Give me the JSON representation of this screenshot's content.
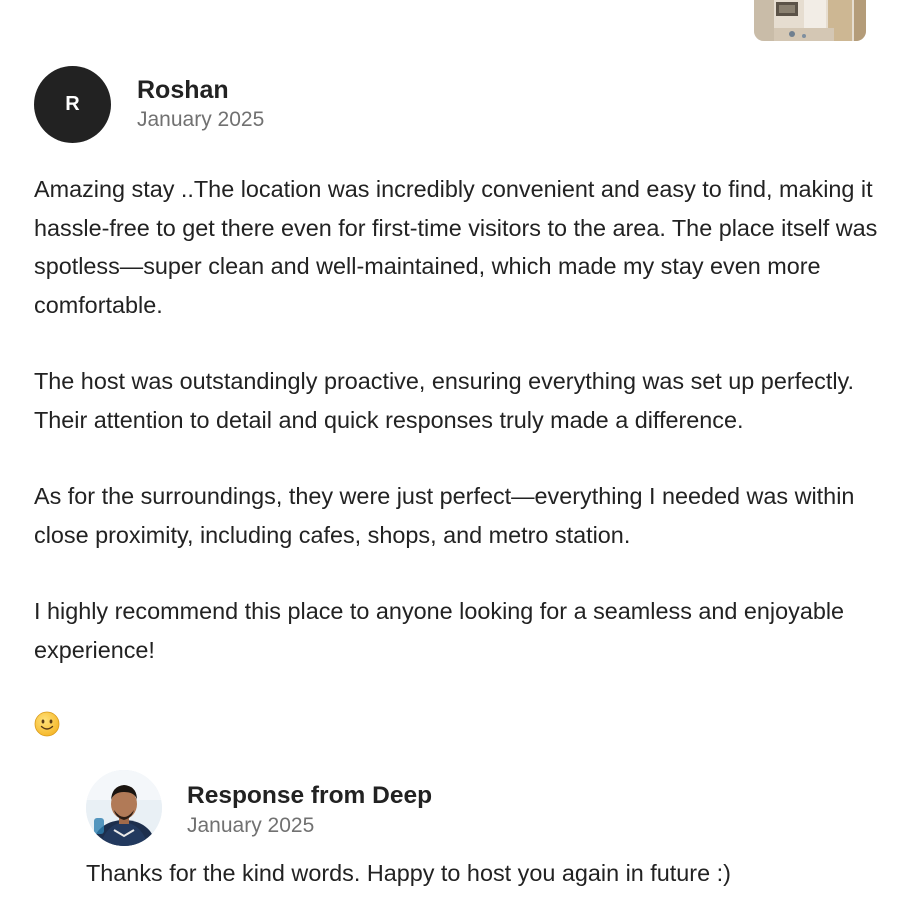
{
  "review": {
    "avatar_initial": "R",
    "author": "Roshan",
    "date": "January 2025",
    "paragraphs": [
      "Amazing stay ..The location was incredibly convenient and easy to find, making it hassle-free to get there even for first-time visitors to the area. The place itself was spotless—super clean and well-maintained, which made my stay even more comfortable.",
      "The host was outstandingly proactive, ensuring everything was set up perfectly. Their attention to detail and quick responses truly made a difference.",
      "As for the surroundings, they were just perfect—everything I needed was within close proximity, including cafes, shops, and metro station.",
      "I highly recommend this place to anyone looking for a seamless and enjoyable experience!"
    ],
    "emoji_icon": "slightly-smiling-face-icon"
  },
  "response": {
    "title": "Response from Deep",
    "date": "January 2025",
    "text": "Thanks for the kind words. Happy to host you again in future :)"
  },
  "colors": {
    "text_primary": "#222222",
    "text_secondary": "#717171",
    "avatar_bg": "#222222"
  }
}
